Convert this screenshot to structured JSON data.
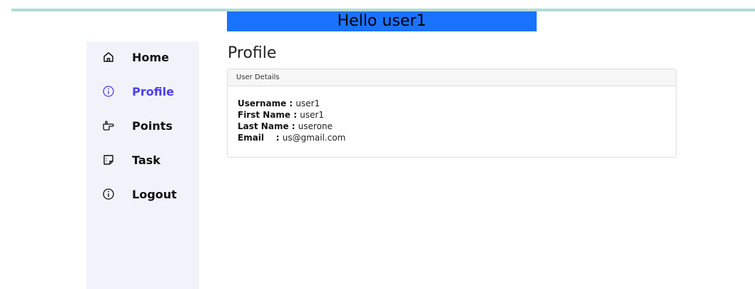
{
  "header": {
    "greeting": "Hello user1"
  },
  "sidebar": {
    "items": [
      {
        "label": "Home",
        "icon": "home-icon",
        "active": false
      },
      {
        "label": "Profile",
        "icon": "info-icon",
        "active": true
      },
      {
        "label": "Points",
        "icon": "pointing-hand-icon",
        "active": false
      },
      {
        "label": "Task",
        "icon": "sticky-note-icon",
        "active": false
      },
      {
        "label": "Logout",
        "icon": "info-icon",
        "active": false
      }
    ]
  },
  "main": {
    "title": "Profile",
    "card": {
      "header": "User Details",
      "rows": [
        {
          "key": "Username",
          "sep": " : ",
          "value": "user1"
        },
        {
          "key": "First Name",
          "sep": " : ",
          "value": "user1"
        },
        {
          "key": "Last Name",
          "sep": " : ",
          "value": "userone"
        },
        {
          "key": "Email",
          "sep": "    : ",
          "value": "us@gmail.com"
        }
      ]
    }
  },
  "colors": {
    "banner": "#1a73ff",
    "active_nav": "#4b3ff0",
    "sidebar_bg": "#f2f3fa",
    "top_rule": "#b3dbd9"
  }
}
